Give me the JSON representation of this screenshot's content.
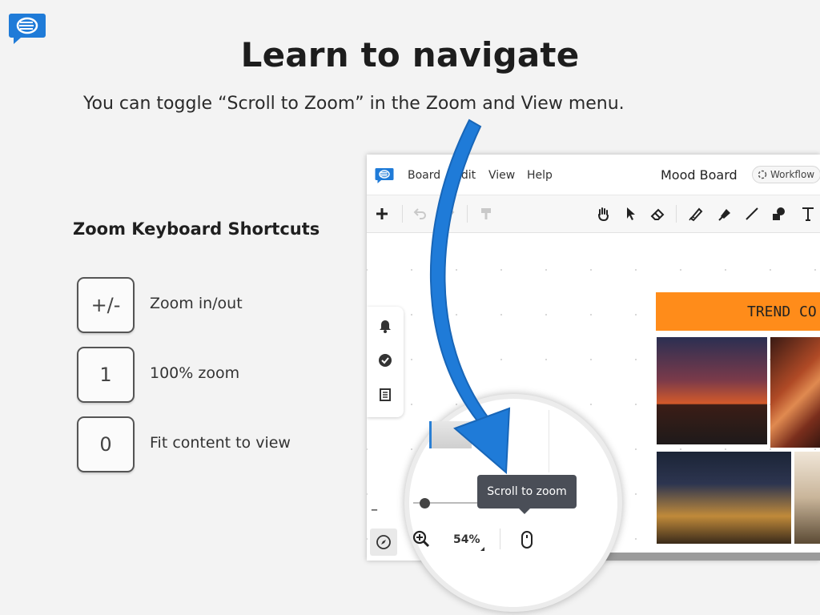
{
  "page": {
    "title": "Learn to navigate",
    "subtitle": "You can toggle “Scroll to Zoom” in the Zoom and View menu."
  },
  "shortcuts": {
    "heading": "Zoom Keyboard Shortcuts",
    "items": [
      {
        "key": "+/-",
        "description": "Zoom in/out"
      },
      {
        "key": "1",
        "description": "100% zoom"
      },
      {
        "key": "0",
        "description": "Fit content to view"
      }
    ]
  },
  "app": {
    "menu": [
      "Board",
      "Edit",
      "View",
      "Help"
    ],
    "board_title": "Mood Board",
    "workflow_label": "Workflow",
    "canvas_header": "TREND CO",
    "tooltip": "Scroll to zoom",
    "zoom_level": "54%"
  },
  "colors": {
    "accent_blue": "#1f7bd8",
    "orange_header": "#ff8c1a",
    "tooltip_bg": "#4a4e57"
  },
  "icons": {
    "toolbar": [
      "plus-icon",
      "undo-icon",
      "redo-icon",
      "format-paint-icon",
      "hand-icon",
      "pointer-icon",
      "eraser-icon",
      "pen-icon",
      "highlighter-icon",
      "line-icon",
      "shapes-icon",
      "text-icon"
    ],
    "side_panel": [
      "bell-icon",
      "check-circle-icon",
      "list-icon"
    ],
    "zoom": [
      "compass-icon",
      "zoom-in-icon",
      "mouse-icon"
    ]
  }
}
